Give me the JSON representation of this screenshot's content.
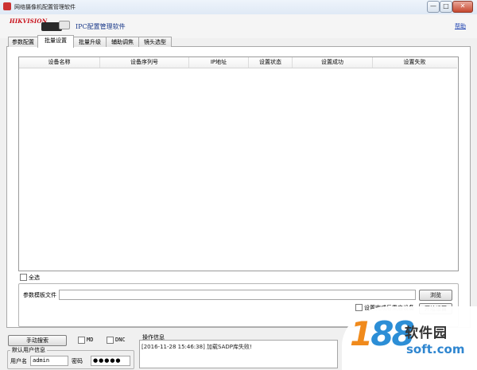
{
  "window": {
    "title": "网络摄像机配置管理软件",
    "controls": [
      "—",
      "□",
      "✕"
    ]
  },
  "header": {
    "logo": "HIKVISION",
    "app_title": "IPC配置管理软件",
    "help": "帮助"
  },
  "tabs": [
    {
      "label": "参数配置",
      "active": false
    },
    {
      "label": "批量设置",
      "active": true
    },
    {
      "label": "批量升级",
      "active": false
    },
    {
      "label": "辅助调焦",
      "active": false
    },
    {
      "label": "镜头选型",
      "active": false
    }
  ],
  "table": {
    "columns": [
      "设备名称",
      "设备序列号",
      "IP地址",
      "设置状态",
      "设置成功",
      "设置失败"
    ],
    "rows": []
  },
  "select_all": {
    "label": "全选",
    "checked": false
  },
  "template": {
    "file_label": "参数模板文件",
    "file_value": "",
    "browse_button": "浏览",
    "partial_option": "设置完成后重启设备",
    "start_button": "开始设置"
  },
  "bottom": {
    "search_button": "手动搜索",
    "md_label": "MD",
    "dnc_label": "DNC",
    "default_user": {
      "legend": "默认用户信息",
      "username_label": "用户名",
      "username_value": "admin",
      "password_label": "密码",
      "password_value": "●●●●●"
    },
    "log": {
      "legend": "操作信息",
      "lines": [
        "[2016-11-28 15:46:38] 加载SADP库失败!"
      ]
    }
  },
  "watermark": {
    "number_one": "1",
    "number_rest": "88",
    "text": "软件园",
    "url": "soft.com"
  }
}
